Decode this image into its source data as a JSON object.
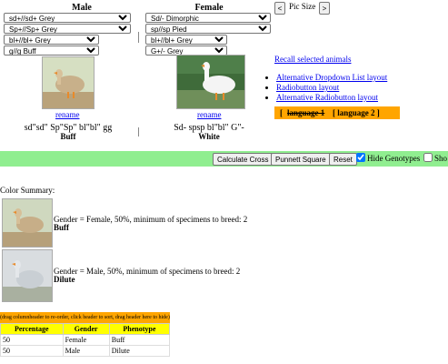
{
  "male": {
    "header": "Male",
    "selects": [
      "sd+//sd+              Grey",
      "Sp+//Sp+              Grey",
      "bl+//bl+         Grey",
      "g//g              Buff"
    ],
    "rename": "rename",
    "genotype": "sd\"sd\" Sp\"Sp\" bl\"bl\" gg",
    "phenotype": "Buff"
  },
  "female": {
    "header": "Female",
    "selects": [
      "Sd/-              Dimorphic",
      "sp//sp               Pied",
      "bl+//bl+         Grey",
      "G+/-             Grey"
    ],
    "rename": "rename",
    "genotype": "Sd- spsp bl\"bl\" G\"-",
    "phenotype": "White"
  },
  "pic_size": {
    "label": "Pic Size",
    "prev": "<",
    "next": ">"
  },
  "recall_link": "Recall selected animals",
  "layout_links": [
    "Alternative Dropdown List layout",
    "Radiobutton layout",
    "Alternative Radiobutton layout"
  ],
  "language": {
    "lang1": "language 1",
    "lang2": "[ language 2 ]",
    "bracket_open": "["
  },
  "toolbar": {
    "calculate": "Calculate Cross",
    "punnett": "Punnett Square",
    "reset": "Reset",
    "hide_genotypes": "Hide Genotypes",
    "sho": "Sho",
    "hide_checked": true
  },
  "color_summary": {
    "title": "Color Summary:",
    "items": [
      {
        "text": "Gender = Female, 50%, minimum of specimens to breed: 2",
        "name": "Buff"
      },
      {
        "text": "Gender = Male, 50%, minimum of specimens to breed: 2",
        "name": "Dilute"
      }
    ]
  },
  "table": {
    "hint": "(drag columnheader to re-order, click header to sort, drag header here to hide)",
    "headers": [
      "Percentage",
      "Gender",
      "Phenotype"
    ],
    "rows": [
      [
        "50",
        "Female",
        "Buff"
      ],
      [
        "50",
        "Male",
        "Dilute"
      ]
    ]
  },
  "colors": {
    "toolbar_bg": "#90ee90",
    "language_bg": "#ffa500",
    "table_header": "#ffff00",
    "hint_bg": "#ffa500"
  }
}
